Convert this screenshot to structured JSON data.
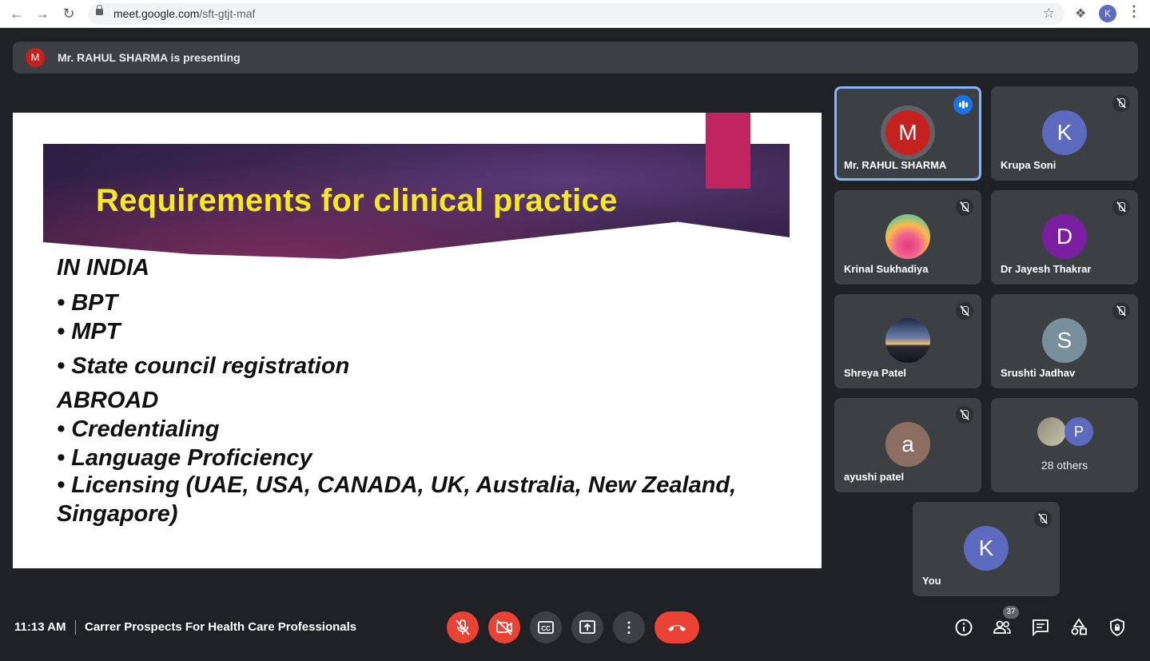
{
  "browser": {
    "url_host": "meet.google.com",
    "url_path": "/sft-gtjt-maf",
    "profile_initial": "K"
  },
  "banner": {
    "avatar_initial": "M",
    "text": "Mr. RAHUL SHARMA is presenting"
  },
  "slide": {
    "title": "Requirements for clinical practice",
    "lines": [
      "IN INDIA",
      "• BPT",
      "• MPT",
      "• State council registration",
      "ABROAD",
      "• Credentialing",
      "• Language Proficiency",
      "• Licensing (UAE, USA, CANADA, UK, Australia, New Zealand,",
      "Singapore)"
    ]
  },
  "participants": [
    {
      "name": "Mr. RAHUL SHARMA",
      "initial": "M",
      "color": "#c5221f",
      "speaking": true
    },
    {
      "name": "Krupa Soni",
      "initial": "K",
      "color": "#5c6bc0",
      "muted": true
    },
    {
      "name": "Krinal Sukhadiya",
      "initial": "",
      "photo": "flower",
      "muted": true
    },
    {
      "name": "Dr Jayesh Thakrar",
      "initial": "D",
      "color": "#7b1fa2",
      "muted": true
    },
    {
      "name": "Shreya Patel",
      "initial": "",
      "photo": "sunset",
      "muted": true
    },
    {
      "name": "Srushti Jadhav",
      "initial": "S",
      "color": "#78909c",
      "muted": true
    },
    {
      "name": "ayushi patel",
      "initial": "a",
      "color": "#8d6e63",
      "muted": true
    },
    {
      "name": "You",
      "initial": "K",
      "color": "#5c6bc0",
      "muted": true
    }
  ],
  "others": {
    "avatar_initial": "P",
    "label": "28 others"
  },
  "bottom": {
    "time": "11:13 AM",
    "meeting_title": "Carrer Prospects For Health Care Professionals",
    "participant_count": "37"
  }
}
